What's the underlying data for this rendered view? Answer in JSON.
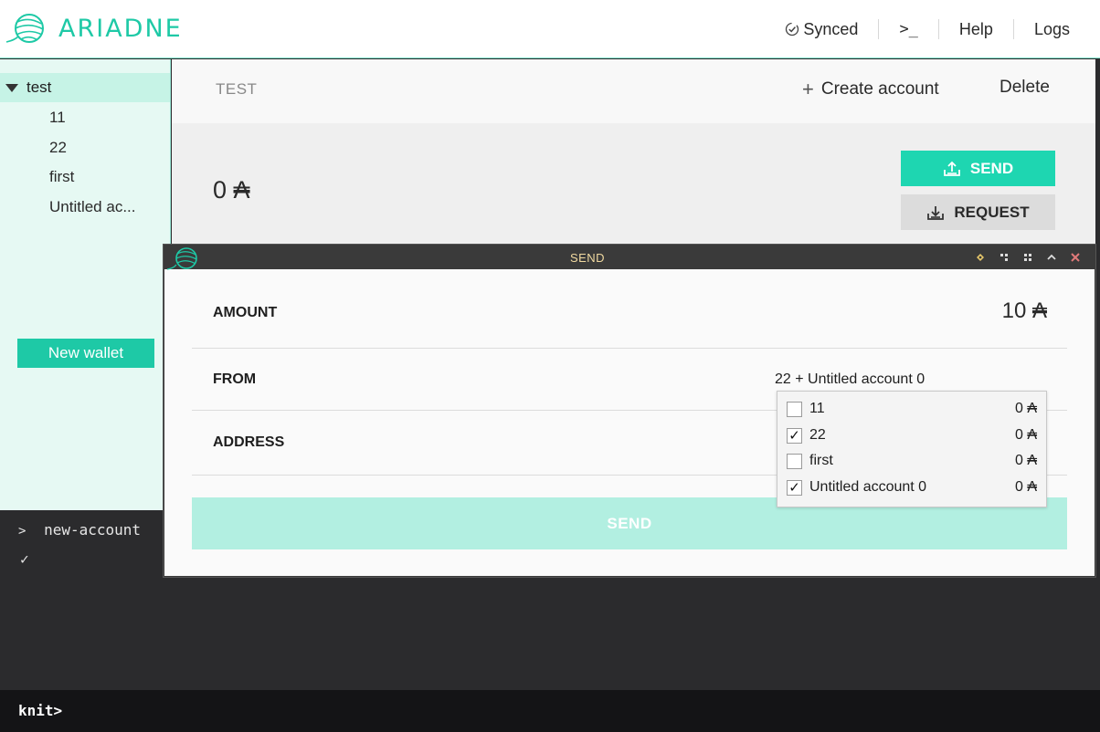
{
  "header": {
    "brand": "ARIADNE",
    "nav": {
      "synced": "Synced",
      "console": ">_",
      "help": "Help",
      "logs": "Logs"
    }
  },
  "sidebar": {
    "wallet": "test",
    "accounts": [
      "11",
      "22",
      "first",
      "Untitled ac..."
    ],
    "new_wallet": "New wallet"
  },
  "main": {
    "wallet_title": "TEST",
    "create_account": "Create account",
    "delete": "Delete",
    "balance": "0",
    "currency_symbol": "₳",
    "send": "SEND",
    "request": "REQUEST"
  },
  "dialog": {
    "title": "SEND",
    "amount_label": "AMOUNT",
    "amount_value": "10",
    "from_label": "FROM",
    "from_value": "22 + Untitled account 0",
    "address_label": "ADDRESS",
    "send_button": "SEND",
    "accounts": [
      {
        "name": "11",
        "checked": false,
        "balance": "0"
      },
      {
        "name": "22",
        "checked": true,
        "balance": "0"
      },
      {
        "name": "first",
        "checked": false,
        "balance": "0"
      },
      {
        "name": "Untitled account 0",
        "checked": true,
        "balance": "0"
      }
    ]
  },
  "console": {
    "prompt_symbol": ">",
    "command": "new-account",
    "result": "✓"
  },
  "cli": {
    "prompt": "knit>"
  },
  "colors": {
    "accent": "#1ed6b1",
    "accent_light": "#b2efe1",
    "sidebar_bg": "#e6f9f3",
    "console_bg": "#2b2b2d"
  }
}
